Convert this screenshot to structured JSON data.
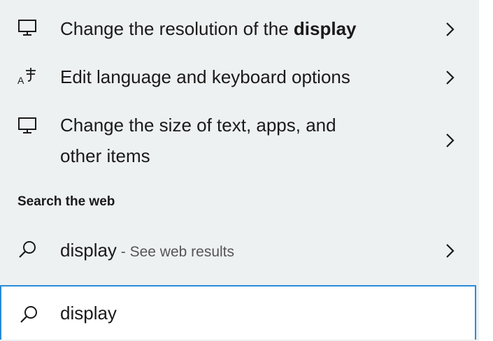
{
  "results": [
    {
      "icon": "monitor-icon",
      "text_before": "Change the resolution of the ",
      "text_bold": "display",
      "chevron": "chevron-right-icon"
    },
    {
      "icon": "language-icon",
      "text": "Edit language and keyboard options",
      "chevron": "chevron-right-icon"
    },
    {
      "icon": "monitor-icon",
      "line1": "Change the size of text, apps, and",
      "line2": "other items",
      "chevron": "chevron-right-icon"
    }
  ],
  "web_section": {
    "header": "Search the web",
    "result": {
      "icon": "search-icon",
      "query": "display",
      "suffix": " - See web results",
      "chevron": "chevron-right-icon"
    }
  },
  "search_box": {
    "icon": "search-icon",
    "value": "display"
  },
  "colors": {
    "panel_bg": "#eef1f2",
    "search_border": "#2a8bd8",
    "text": "#1a1a1a",
    "muted_text": "#555555"
  }
}
